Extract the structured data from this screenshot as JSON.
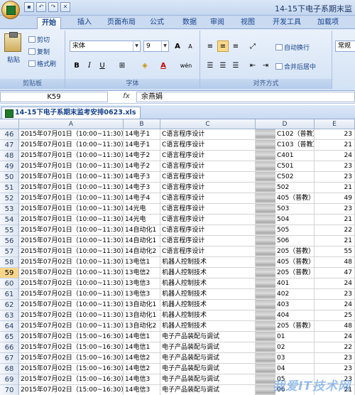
{
  "title": "14-15下电子系期末监",
  "qat": [
    "save-icon",
    "undo-icon",
    "redo-icon",
    "close-icon"
  ],
  "tabs": [
    "开始",
    "插入",
    "页面布局",
    "公式",
    "数据",
    "审阅",
    "视图",
    "开发工具",
    "加载项"
  ],
  "clipboard": {
    "paste": "粘贴",
    "cut": "剪切",
    "copy": "复制",
    "format_painter": "格式刷",
    "label": "剪贴板"
  },
  "font": {
    "name": "宋体",
    "size": "9",
    "label": "字体",
    "bold": "B",
    "italic": "I",
    "underline": "U",
    "grow": "A",
    "shrink": "A",
    "color_a": "A",
    "phonetic": "wén"
  },
  "alignment": {
    "wrap": "自动换行",
    "merge": "合并后居中",
    "label": "对齐方式"
  },
  "number": {
    "format": "常规"
  },
  "formula": {
    "namebox": "K59",
    "fx": "fx",
    "value": "余燕娟"
  },
  "workbook": {
    "tab": "14-15下电子系期末监考安排0623.xls"
  },
  "columns": [
    "A",
    "B",
    "C",
    "D",
    "E"
  ],
  "rows": [
    {
      "n": "46",
      "a": "2015年07月01日（10:00~11:30）",
      "b": "14电子1",
      "c": "C语言程序设计",
      "d": "C102（普教）",
      "e": "23"
    },
    {
      "n": "47",
      "a": "2015年07月01日（10:00~11:30）",
      "b": "14电子1",
      "c": "C语言程序设计",
      "d": "C103（普教）",
      "e": "21"
    },
    {
      "n": "48",
      "a": "2015年07月01日（10:00~11:30）",
      "b": "14电子2",
      "c": "C语言程序设计",
      "d": "C401",
      "e": "24"
    },
    {
      "n": "49",
      "a": "2015年07月01日（10:00~11:30）",
      "b": "14电子2",
      "c": "C语言程序设计",
      "d": "C501",
      "e": "23"
    },
    {
      "n": "50",
      "a": "2015年07月01日（10:00~11:30）",
      "b": "14电子3",
      "c": "C语言程序设计",
      "d": "C502",
      "e": "23"
    },
    {
      "n": "51",
      "a": "2015年07月01日（10:00~11:30）",
      "b": "14电子3",
      "c": "C语言程序设计",
      "d": "502",
      "e": "21"
    },
    {
      "n": "52",
      "a": "2015年07月01日（10:00~11:30）",
      "b": "14电子4",
      "c": "C语言程序设计",
      "d": "405（普教）",
      "e": "49"
    },
    {
      "n": "53",
      "a": "2015年07月01日（10:00~11:30）",
      "b": "14光电",
      "c": "C语言程序设计",
      "d": "503",
      "e": "23"
    },
    {
      "n": "54",
      "a": "2015年07月01日（10:00~11:30）",
      "b": "14光电",
      "c": "C语言程序设计",
      "d": "504",
      "e": "21"
    },
    {
      "n": "55",
      "a": "2015年07月01日（10:00~11:30）",
      "b": "14自动化1",
      "c": "C语言程序设计",
      "d": "505",
      "e": "22"
    },
    {
      "n": "56",
      "a": "2015年07月01日（10:00~11:30）",
      "b": "14自动化1",
      "c": "C语言程序设计",
      "d": "506",
      "e": "21"
    },
    {
      "n": "57",
      "a": "2015年07月01日（10:00~11:30）",
      "b": "14自动化2",
      "c": "C语言程序设计",
      "d": "205（普教）",
      "e": "55"
    },
    {
      "n": "58",
      "a": "2015年07月02日（10:00~11:30）",
      "b": "13电信1",
      "c": "机器人控制技术",
      "d": "405（普教）",
      "e": "48"
    },
    {
      "n": "59",
      "a": "2015年07月02日（10:00~11:30）",
      "b": "13电信2",
      "c": "机器人控制技术",
      "d": "205（普教）",
      "e": "47"
    },
    {
      "n": "60",
      "a": "2015年07月02日（10:00~11:30）",
      "b": "13电信3",
      "c": "机器人控制技术",
      "d": "401",
      "e": "24"
    },
    {
      "n": "61",
      "a": "2015年07月02日（10:00~11:30）",
      "b": "13电信3",
      "c": "机器人控制技术",
      "d": "402",
      "e": "23"
    },
    {
      "n": "62",
      "a": "2015年07月02日（10:00~11:30）",
      "b": "13自动化1",
      "c": "机器人控制技术",
      "d": "403",
      "e": "24"
    },
    {
      "n": "63",
      "a": "2015年07月02日（10:00~11:30）",
      "b": "13自动化1",
      "c": "机器人控制技术",
      "d": "404",
      "e": "25"
    },
    {
      "n": "64",
      "a": "2015年07月02日（10:00~11:30）",
      "b": "13自动化2",
      "c": "机器人控制技术",
      "d": "205（普教）",
      "e": "48"
    },
    {
      "n": "65",
      "a": "2015年07月02日（15:00~16:30）",
      "b": "14电信1",
      "c": "电子产品装配与调试",
      "d": "01",
      "e": "24"
    },
    {
      "n": "66",
      "a": "2015年07月02日（15:00~16:30）",
      "b": "14电信1",
      "c": "电子产品装配与调试",
      "d": "02",
      "e": "22"
    },
    {
      "n": "67",
      "a": "2015年07月02日（15:00~16:30）",
      "b": "14电信2",
      "c": "电子产品装配与调试",
      "d": "03",
      "e": "23"
    },
    {
      "n": "68",
      "a": "2015年07月02日（15:00~16:30）",
      "b": "14电信2",
      "c": "电子产品装配与调试",
      "d": "04",
      "e": "23"
    },
    {
      "n": "69",
      "a": "2015年07月02日（15:00~16:30）",
      "b": "14电信3",
      "c": "电子产品装配与调试",
      "d": "05",
      "e": "23"
    },
    {
      "n": "70",
      "a": "2015年07月02日（15:00~16:30）",
      "b": "14电信3",
      "c": "电子产品装配与调试",
      "d": "06",
      "e": "21"
    }
  ],
  "selected_row": "59",
  "watermark": "我爱IT技术网"
}
